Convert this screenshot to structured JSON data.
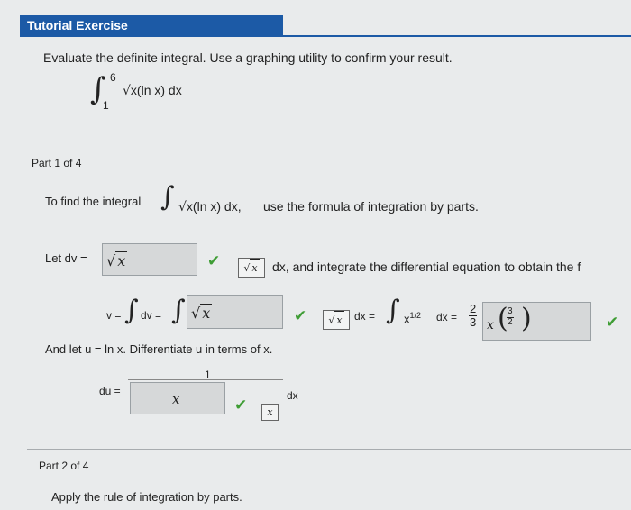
{
  "header": {
    "title": "Tutorial Exercise"
  },
  "problem": {
    "instruction": "Evaluate the definite integral. Use a graphing utility to confirm your result.",
    "upper_limit": "6",
    "lower_limit": "1",
    "integrand": "x(ln x) dx"
  },
  "part1": {
    "label": "Part 1 of 4",
    "intro_before": "To find the integral",
    "intro_integrand": "x(ln x) dx,",
    "intro_after": "use the formula of integration by parts.",
    "let_dv_label": "Let dv =",
    "dv_answer": "x",
    "dv_key_symbol": "x",
    "dv_suffix": "dx, and integrate the differential equation to obtain the f",
    "v_label": "v =",
    "dv_text": "dv =",
    "v_answer": "x",
    "v_key_symbol": "x",
    "dx_eq": "dx =",
    "power_term": "x",
    "power_exp": "1/2",
    "dx_eq2": "dx =",
    "coef_num": "2",
    "coef_den": "3",
    "result_base": "x",
    "result_exp_num": "3",
    "result_exp_den": "2",
    "let_u_text": "And let  u = ln x.  Differentiate  u  in terms of  x.",
    "du_label": "du =",
    "du_numerator": "1",
    "du_answer": "x",
    "du_suffix": "dx",
    "du_key_symbol": "x"
  },
  "part2": {
    "label": "Part 2 of 4",
    "instruction": "Apply the rule of integration by parts."
  },
  "colors": {
    "header": "#1c5aa6",
    "check": "#3f9d35",
    "answer_box": "#d6d8d9"
  }
}
